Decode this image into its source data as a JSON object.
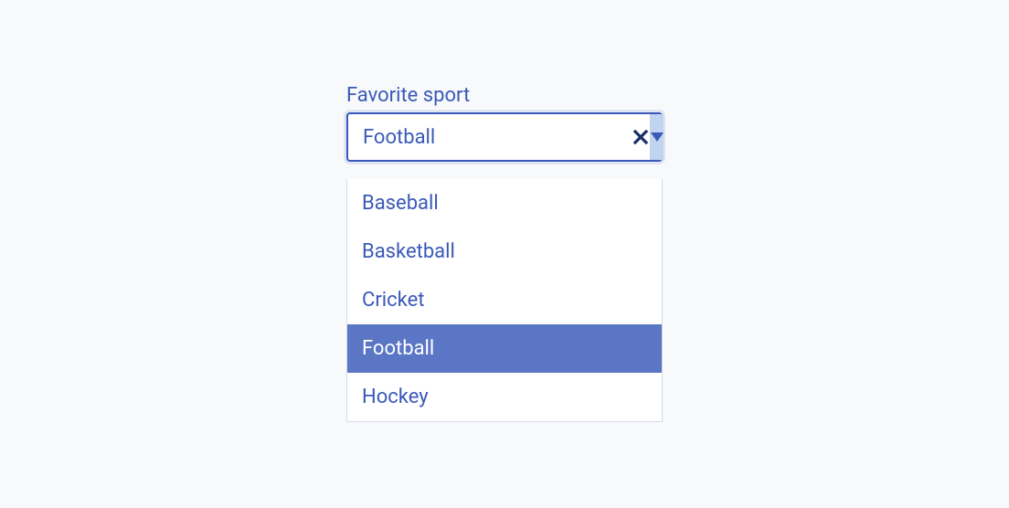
{
  "combo": {
    "label": "Favorite sport",
    "selectedValue": "Football",
    "options": [
      {
        "label": "Baseball",
        "selected": false
      },
      {
        "label": "Basketball",
        "selected": false
      },
      {
        "label": "Cricket",
        "selected": false
      },
      {
        "label": "Football",
        "selected": true
      },
      {
        "label": "Hockey",
        "selected": false
      }
    ]
  }
}
